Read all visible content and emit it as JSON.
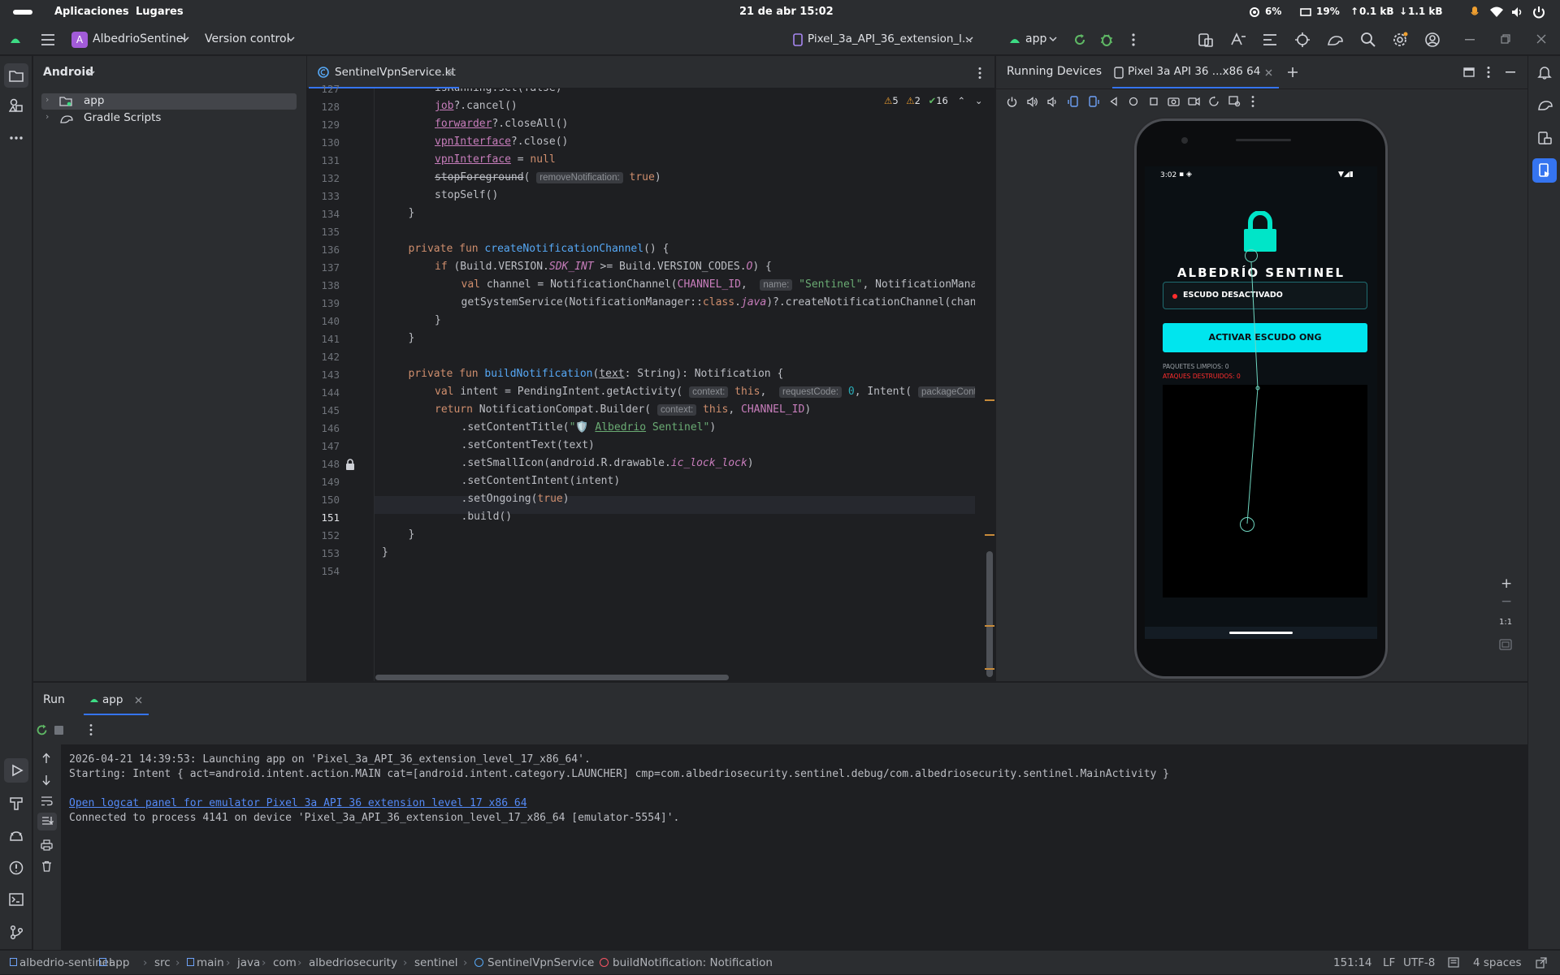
{
  "gnome": {
    "apps": "Aplicaciones",
    "places": "Lugares",
    "clock": "21 de abr  15:02",
    "cpu": "6%",
    "mem": "19%",
    "up": "0.1 kB",
    "down": "1.1 kB"
  },
  "toolbar": {
    "project_letter": "A",
    "project_name": "AlbedrioSentinel",
    "vcs": "Version control",
    "device": "Pixel_3a_API_36_extension_l...",
    "run_config": "app"
  },
  "project_panel": {
    "view": "Android",
    "items": [
      "app",
      "Gradle Scripts"
    ]
  },
  "editor": {
    "tab": "SentinelVpnService.kt",
    "warnings": "5",
    "weak_warnings": "2",
    "ok": "16",
    "line_numbers": [
      "127",
      "128",
      "129",
      "130",
      "131",
      "132",
      "133",
      "134",
      "135",
      "136",
      "137",
      "138",
      "139",
      "140",
      "141",
      "142",
      "143",
      "144",
      "145",
      "146",
      "147",
      "148",
      "149",
      "150",
      "151",
      "152",
      "153",
      "154"
    ],
    "code": {
      "l127a": "isRunning.set(false)",
      "l128a": "job",
      "l128b": "?.cancel()",
      "l129a": "forwarder",
      "l129b": "?.closeAll()",
      "l130a": "vpnInterface",
      "l130b": "?.close()",
      "l131a": "vpnInterface",
      "l131b": " = ",
      "l131c": "null",
      "l132a": "stopForeground",
      "l132b": "( ",
      "l132h": "removeNotification:",
      "l132c": " true",
      "l132d": ")",
      "l133a": "stopSelf()",
      "l134a": "}",
      "l136a": "private fun ",
      "l136b": "createNotificationChannel",
      "l136c": "() {",
      "l137a": "if ",
      "l137b": "(Build.VERSION.",
      "l137c": "SDK_INT",
      "l137d": " >= Build.VERSION_CODES.",
      "l137e": "O",
      "l137f": ") {",
      "l138a": "val ",
      "l138b": "channel = NotificationChannel(",
      "l138c": "CHANNEL_ID",
      "l138d": ",  ",
      "l138h": "name:",
      "l138e": " \"Sentinel\"",
      "l138f": ", NotificationManager",
      "l139a": "getSystemService(NotificationManager::",
      "l139b": "class",
      "l139c": ".",
      "l139d": "java",
      "l139e": ")?.createNotificationChannel(channe",
      "l140a": "}",
      "l141a": "}",
      "l143a": "private fun ",
      "l143b": "buildNotification",
      "l143c": "(",
      "l143d": "text",
      "l143e": ": String): Notification {",
      "l144a": "val ",
      "l144b": "intent = PendingIntent.getActivity( ",
      "l144h1": "context:",
      "l144c": " this",
      "l144d": ",  ",
      "l144h2": "requestCode:",
      "l144e": " 0",
      "l144f": ", Intent( ",
      "l144h3": "packageContext:",
      "l145a": "return ",
      "l145b": "NotificationCompat.Builder( ",
      "l145h": "context:",
      "l145c": " this",
      "l145d": ", ",
      "l145e": "CHANNEL_ID",
      "l145f": ")",
      "l146a": ".setContentTitle(",
      "l146b": "\"🛡️ ",
      "l146c": "Albedrio",
      "l146d": " Sentinel\"",
      "l146e": ")",
      "l147a": ".setContentText(text)",
      "l148a": ".setSmallIcon(android.R.drawable.",
      "l148b": "ic_lock_lock",
      "l148c": ")",
      "l149a": ".setContentIntent(intent)",
      "l150a": ".setOngoing(",
      "l150b": "true",
      "l150c": ")",
      "l151a": ".build()",
      "l152a": "}",
      "l153a": "}"
    }
  },
  "devices": {
    "title": "Running Devices",
    "tab": "Pixel 3a API 36 ...x86 64",
    "zoom_label": "1:1",
    "phone": {
      "time": "3:02",
      "app_title": "ALBEDRÍO SENTINEL",
      "status": "ESCUDO DESACTIVADO",
      "button": "ACTIVAR ESCUDO ONG",
      "packets": "PAQUETES LIMPIOS: 0",
      "attacks": "ATAQUES DESTRUIDOS: 0"
    }
  },
  "run": {
    "tab_run": "Run",
    "tab_app": "app",
    "lines": [
      "2026-04-21 14:39:53: Launching app on 'Pixel_3a_API_36_extension_level_17_x86_64'.",
      "Starting: Intent { act=android.intent.action.MAIN cat=[android.intent.category.LAUNCHER] cmp=com.albedriosecurity.sentinel.debug/com.albedriosecurity.sentinel.MainActivity }",
      "Open logcat panel for emulator Pixel 3a API 36 extension level 17 x86 64",
      "Connected to process 4141 on device 'Pixel_3a_API_36_extension_level_17_x86_64 [emulator-5554]'."
    ]
  },
  "statusbar": {
    "crumbs": [
      "albedrio-sentinel",
      "app",
      "src",
      "main",
      "java",
      "com",
      "albedriosecurity",
      "sentinel",
      "SentinelVpnService",
      "buildNotification: Notification"
    ],
    "position": "151:14",
    "line_sep": "LF",
    "encoding": "UTF-8",
    "indent": "4 spaces"
  },
  "colors": {
    "accent": "#00e5ee",
    "danger": "#ff2d2d",
    "ide_bg": "#1e1f22",
    "panel_bg": "#2b2d30"
  }
}
